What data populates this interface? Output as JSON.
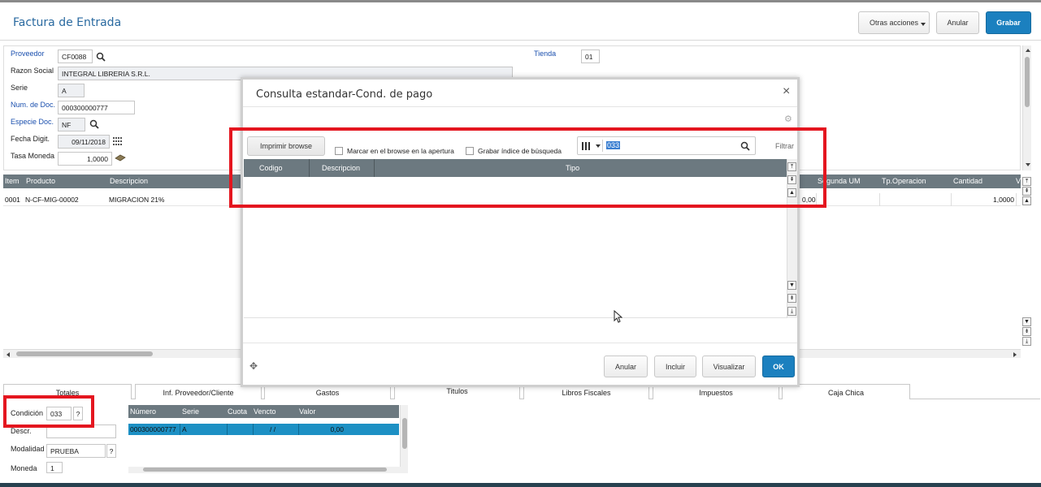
{
  "header": {
    "title": "Factura de Entrada",
    "otras_acciones": "Otras acciones",
    "anular": "Anular",
    "grabar": "Grabar"
  },
  "form": {
    "proveedor_label": "Proveedor",
    "proveedor_value": "CF0088",
    "tienda_label": "Tienda",
    "tienda_value": "01",
    "razon_label": "Razon Social",
    "razon_value": "INTEGRAL LIBRERIA S.R.L.",
    "serie_label": "Serie",
    "serie_value": "A",
    "numdoc_label": "Num. de Doc.",
    "numdoc_value": "000300000777",
    "especie_label": "Especie Doc.",
    "especie_value": "NF",
    "fecha_label": "Fecha Digit.",
    "fecha_value": "09/11/2018",
    "tasa_label": "Tasa Moneda",
    "tasa_value": "1,0000"
  },
  "items_grid": {
    "columns": [
      "Item",
      "Producto",
      "Descripcion",
      "Segunda UM",
      "Tp.Operacion",
      "Cantidad",
      "V"
    ],
    "rows": [
      {
        "item": "0001",
        "producto": "N-CF-MIG-00002",
        "descripcion": "MIGRACION 21%",
        "col_value": "0,00",
        "cantidad": "1,0000"
      }
    ]
  },
  "tabs": [
    "Totales",
    "Inf. Proveedor/Cliente",
    "Gastos",
    "Titulos",
    "Libros Fiscales",
    "Impuestos",
    "Caja Chica"
  ],
  "bottom_form": {
    "condicion_label": "Condición",
    "condicion_value": "033",
    "q_mark": "?",
    "descr_label": "Descr.",
    "modalidad_label": "Modalidad",
    "modalidad_value": "PRUEBA",
    "moneda_label": "Moneda",
    "moneda_value": "1"
  },
  "titulos_grid": {
    "columns": [
      "Número",
      "Serie",
      "Cuota",
      "Vencto",
      "Valor"
    ],
    "row": {
      "numero": "000300000777",
      "serie": "A",
      "cuota": "",
      "vencto": "/ /",
      "valor": "0,00"
    }
  },
  "modal": {
    "title": "Consulta estandar-Cond. de pago",
    "close": "×",
    "imprimir": "Imprimir browse",
    "marcar": "Marcar en el browse en la apertura",
    "grabar_indice": "Grabar índice de búsqueda",
    "search_value": "033",
    "filtrar": "Filtrar",
    "columns": [
      "Codigo",
      "Descripcion",
      "Tipo"
    ],
    "btn_anular": "Anular",
    "btn_incluir": "Incluir",
    "btn_visualizar": "Visualizar",
    "btn_ok": "OK"
  },
  "colors": {
    "accent": "#1b80bf",
    "highlight": "#e4161f",
    "grid_header": "#6c7980",
    "selected_row": "#1d90c4"
  }
}
